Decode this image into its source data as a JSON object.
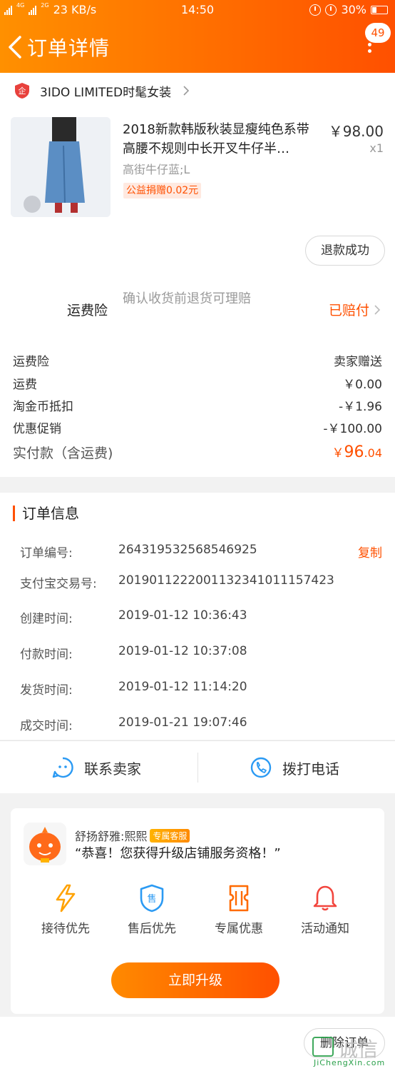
{
  "status_bar": {
    "network": "4G",
    "network2": "2G",
    "speed": "23 KB/s",
    "time": "14:50",
    "battery": "30%"
  },
  "nav": {
    "title": "订单详情",
    "badge": "49"
  },
  "store": {
    "name": "3IDO LIMITED时髦女装"
  },
  "product": {
    "title": "2018新款韩版秋装显瘦纯色系带高腰不规则中长开叉牛仔半…",
    "price": "￥98.00",
    "qty": "x1",
    "sku": "高街牛仔蓝;L",
    "charity": "公益捐赠0.02元",
    "refund_label": "退款成功"
  },
  "insurance": {
    "label": "运费险",
    "desc": "确认收货前退货可理赔",
    "status": "已赔付"
  },
  "price_rows": [
    {
      "label": "运费险",
      "value": "卖家赠送"
    },
    {
      "label": "运费",
      "value": "￥0.00"
    },
    {
      "label": "淘金币抵扣",
      "value": "-￥1.96"
    },
    {
      "label": "优惠促销",
      "value": "-￥100.00"
    }
  ],
  "total": {
    "label": "实付款（含运费)",
    "currency": "￥",
    "int": "96",
    "dec": ".04"
  },
  "order_info": {
    "heading": "订单信息",
    "copy_label": "复制",
    "rows": [
      {
        "key": "订单编号:",
        "value": "264319532568546925"
      },
      {
        "key": "支付宝交易号:",
        "value": "2019011222001132341011157423"
      },
      {
        "key": "创建时间:",
        "value": "2019-01-12 10:36:43"
      },
      {
        "key": "付款时间:",
        "value": "2019-01-12 10:37:08"
      },
      {
        "key": "发货时间:",
        "value": "2019-01-12 11:14:20"
      },
      {
        "key": "成交时间:",
        "value": "2019-01-21 19:07:46"
      }
    ]
  },
  "contact": {
    "seller": "联系卖家",
    "phone": "拨打电话"
  },
  "upgrade": {
    "name": "舒扬舒雅:熙熙",
    "tag": "专属客服",
    "message": "“恭喜！您获得升级店铺服务资格！”",
    "perks": [
      "接待优先",
      "售后优先",
      "专属优惠",
      "活动通知"
    ],
    "button": "立即升级"
  },
  "bottom": {
    "delete_label": "删除订单"
  },
  "watermark": {
    "text": "诚信",
    "sub": "JiChengXin.com"
  },
  "colors": {
    "brand": "#ff5000",
    "brand_light": "#ff9000"
  }
}
